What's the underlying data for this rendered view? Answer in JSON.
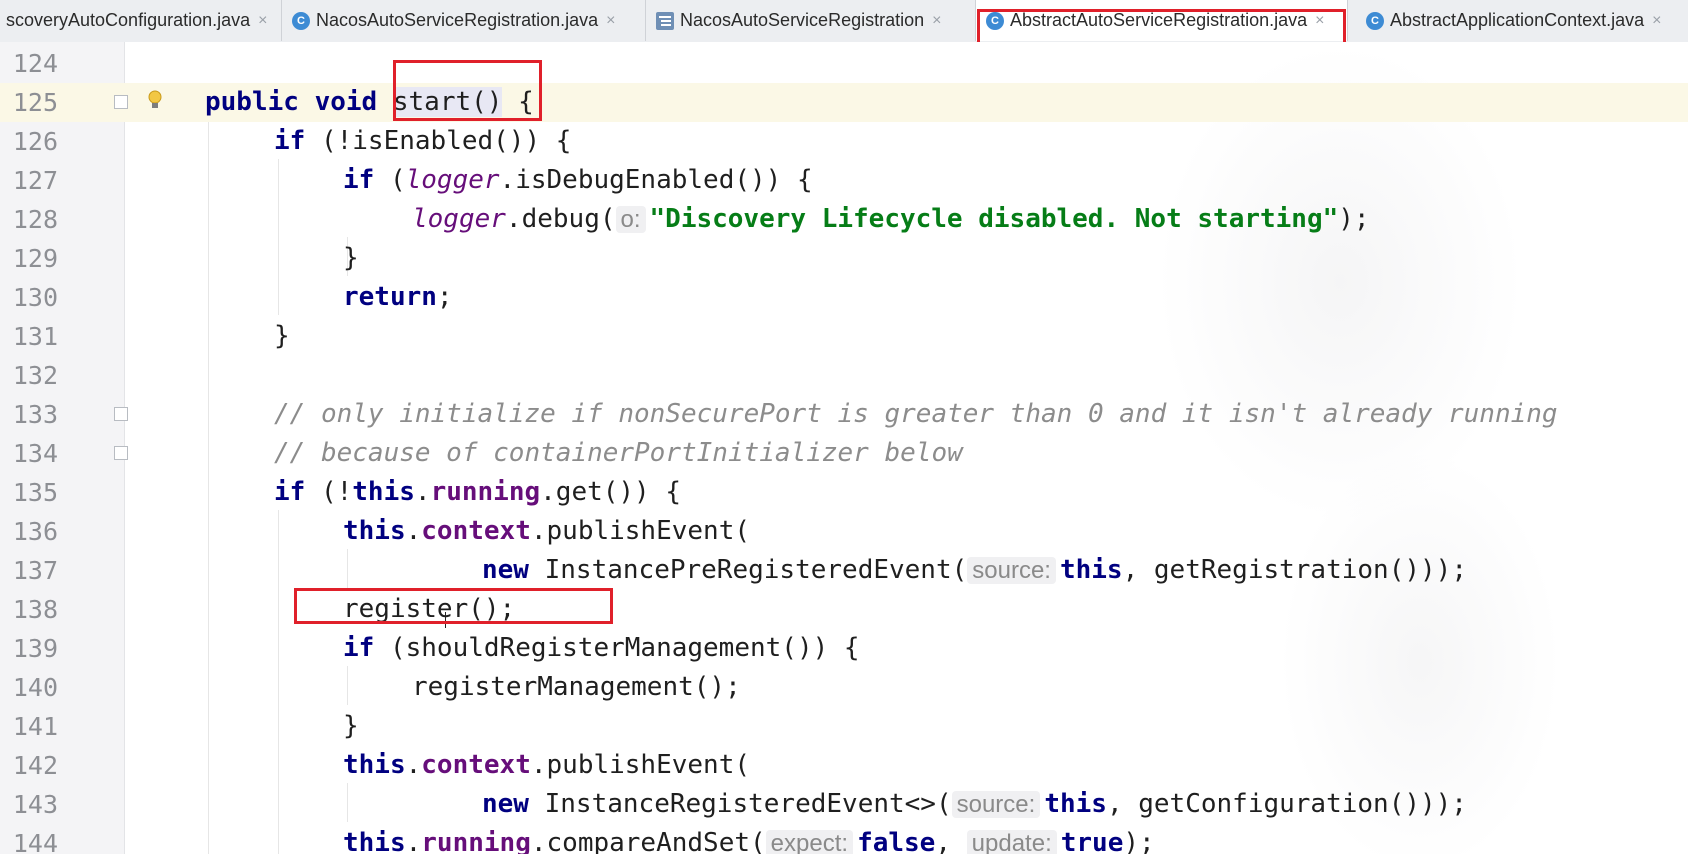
{
  "tabs": [
    {
      "label": "scoveryAutoConfiguration.java",
      "icon": "class-icon",
      "active": false
    },
    {
      "label": "NacosAutoServiceRegistration.java",
      "icon": "class-icon",
      "active": false
    },
    {
      "label": "NacosAutoServiceRegistration",
      "icon": "structure-icon",
      "active": false
    },
    {
      "label": "AbstractAutoServiceRegistration.java",
      "icon": "class-icon",
      "active": true
    },
    {
      "label": "AbstractApplicationContext.java",
      "icon": "class-icon",
      "active": false
    }
  ],
  "tab_icon_letter": "C",
  "close_glyph": "×",
  "colors": {
    "keyword": "#000080",
    "field": "#660e7a",
    "string": "#067d17",
    "comment": "#8c8c8c",
    "highlight_box": "#e0202a",
    "current_line": "#fbf8e6"
  },
  "editor": {
    "line_numbers": [
      "124",
      "125",
      "126",
      "127",
      "128",
      "129",
      "130",
      "131",
      "132",
      "133",
      "134",
      "135",
      "136",
      "137",
      "138",
      "139",
      "140",
      "141",
      "142",
      "143",
      "144"
    ],
    "current_line": "125",
    "code": {
      "l125": {
        "kw1": "public",
        "kw2": "void",
        "method": "start()",
        "rest": " {"
      },
      "l126": {
        "kw": "if",
        "rest": " (!isEnabled()) {"
      },
      "l127": {
        "kw": "if",
        "open": " (",
        "field": "logger",
        "rest": ".isDebugEnabled()) {"
      },
      "l128": {
        "field": "logger",
        "call": ".debug(",
        "hint": "o:",
        "string": "\"Discovery Lifecycle disabled. Not starting\"",
        "rest": ");"
      },
      "l129": {
        "text": "}"
      },
      "l130": {
        "kw": "return",
        "rest": ";"
      },
      "l131": {
        "text": "}"
      },
      "l133": {
        "comment": "// only initialize if nonSecurePort is greater than 0 and it isn't already running"
      },
      "l134": {
        "comment": "// because of containerPortInitializer below"
      },
      "l135": {
        "kw": "if",
        "open": " (!",
        "this": "this",
        "dot": ".",
        "field": "running",
        "rest": ".get()) {"
      },
      "l136": {
        "this": "this",
        "dot": ".",
        "field": "context",
        "rest": ".publishEvent("
      },
      "l137": {
        "kw": "new",
        "cls": " InstancePreRegisteredEvent(",
        "hint": "source:",
        "this": "this",
        "rest": ", getRegistration()));"
      },
      "l138": {
        "text": "register();"
      },
      "l139": {
        "kw": "if",
        "rest": " (shouldRegisterManagement()) {"
      },
      "l140": {
        "text": "registerManagement();"
      },
      "l141": {
        "text": "}"
      },
      "l142": {
        "this": "this",
        "dot": ".",
        "field": "context",
        "rest": ".publishEvent("
      },
      "l143": {
        "kw": "new",
        "cls": " InstanceRegisteredEvent<>(",
        "hint": "source:",
        "this": "this",
        "rest": ", getConfiguration()));"
      },
      "l144": {
        "this": "this",
        "dot": ".",
        "field": "running",
        "call": ".compareAndSet(",
        "hint1": "expect:",
        "v1": "false",
        "sep": ", ",
        "hint2": "update:",
        "v2": "true",
        "rest": ");"
      }
    }
  }
}
